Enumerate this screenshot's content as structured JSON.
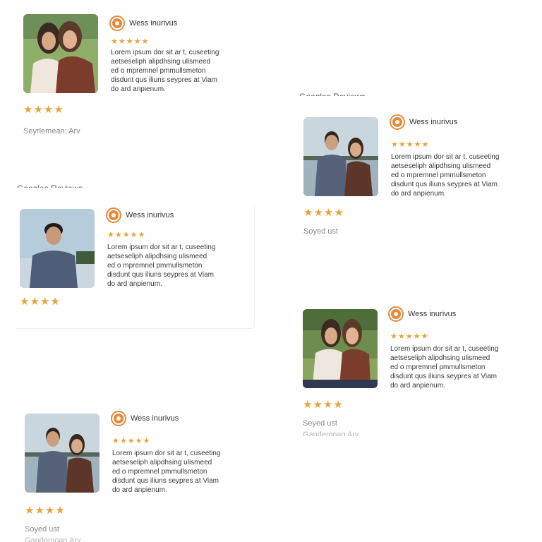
{
  "brand_name": "Wess inurivus",
  "stars_small": "★★★★★",
  "stars_big": "★★★★",
  "body_lines": [
    "Lorem ipsum dor sit ar t, cuseeting",
    "aetseseliph alipdhsing ulismeed",
    "ed o mpremnel pmmullsmeton",
    "disdunt qus iliuns seypres at Viam",
    "do ard anpienum."
  ],
  "headings": {
    "right_top": "Googles Reviews",
    "left_mid": "Googles Reviews"
  },
  "cards": [
    {
      "photo": "two-women-field",
      "meta": "Seyrlemean: Arv",
      "meta2": ""
    },
    {
      "photo": "man-woman-lake",
      "meta": "Soyed ust",
      "meta2": ""
    },
    {
      "photo": "man-lake-solo",
      "meta": "",
      "meta2": ""
    },
    {
      "photo": "two-women-field",
      "meta": "Seyed ust",
      "meta2": "Gandemoan Arv"
    },
    {
      "photo": "man-woman-lake",
      "meta": "Soyed ust",
      "meta2": "Gandemoan Arv"
    }
  ],
  "colors": {
    "accent": "#e8893a",
    "star": "#e8a33a",
    "meta": "#8a8a8a"
  }
}
